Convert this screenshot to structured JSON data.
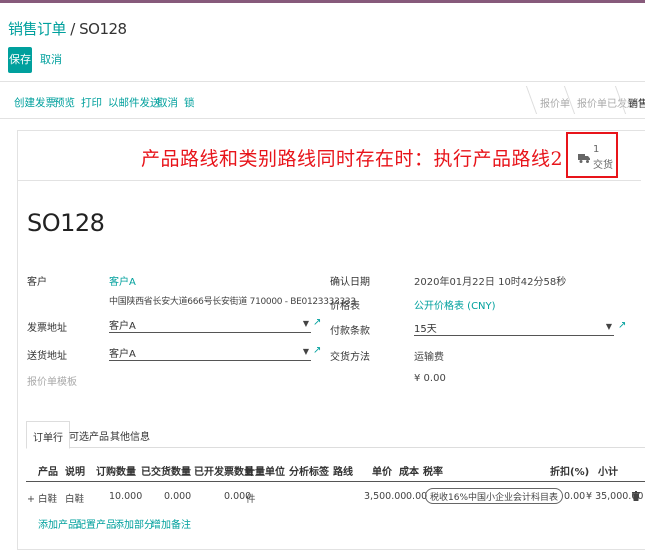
{
  "breadcrumb": {
    "parent": "销售订单",
    "separator": " / ",
    "current": "SO128"
  },
  "control": {
    "save_label": "保存",
    "discard_label": "取消"
  },
  "header_actions": [
    "创建发票",
    "预览",
    "打印",
    "以邮件发送",
    "取消",
    "锁"
  ],
  "statusbar": [
    "报价单",
    "报价单已发送",
    "销售订单"
  ],
  "annotation": "产品路线和类别路线同时存在时：执行产品路线2",
  "smart_button": {
    "count": "1",
    "label": "交货",
    "icon": "truck-icon"
  },
  "order": {
    "name": "SO128",
    "left": {
      "customer_label": "客户",
      "customer_name": "客户A",
      "customer_address": "中国陕西省长安大道666号长安街道 710000 - BE0123333333",
      "invoice_addr_label": "发票地址",
      "invoice_addr_value": "客户A",
      "delivery_addr_label": "送货地址",
      "delivery_addr_value": "客户A",
      "template_label": "报价单模板"
    },
    "right": {
      "date_label": "确认日期",
      "date_value": "2020年01月22日 10时42分58秒",
      "pricelist_label": "价格表",
      "pricelist_value": "公开价格表 (CNY)",
      "terms_label": "付款条款",
      "terms_value": "15天",
      "incoterm_label": "交货方法",
      "incoterm_value": "运输费",
      "delivery_cost_value": "¥ 0.00"
    }
  },
  "tabs": [
    "订单行",
    "可选产品",
    "其他信息"
  ],
  "columns": [
    "产品",
    "说明",
    "订购数量",
    "已交货数量",
    "已开发票数量",
    "计量单位",
    "分析标签",
    "路线",
    "单价",
    "成本",
    "税率",
    "折扣(%)",
    "小计"
  ],
  "line": {
    "product": "+ 白鞋",
    "description": "白鞋",
    "ordered": "10.000",
    "delivered": "0.000",
    "invoiced": "0.000",
    "uom": "件",
    "unit_price": "3,500.00",
    "cost": "0.00",
    "tax": "税收16%中国小企业会计科目表",
    "discount": "0.00",
    "subtotal": "¥ 35,000.00"
  },
  "line_actions": [
    "添加产品",
    "配置产品",
    "添加部分",
    "增加备注"
  ],
  "colors": {
    "brand": "#875a7b",
    "accent": "#00a09d",
    "annotation": "#e8141a"
  }
}
